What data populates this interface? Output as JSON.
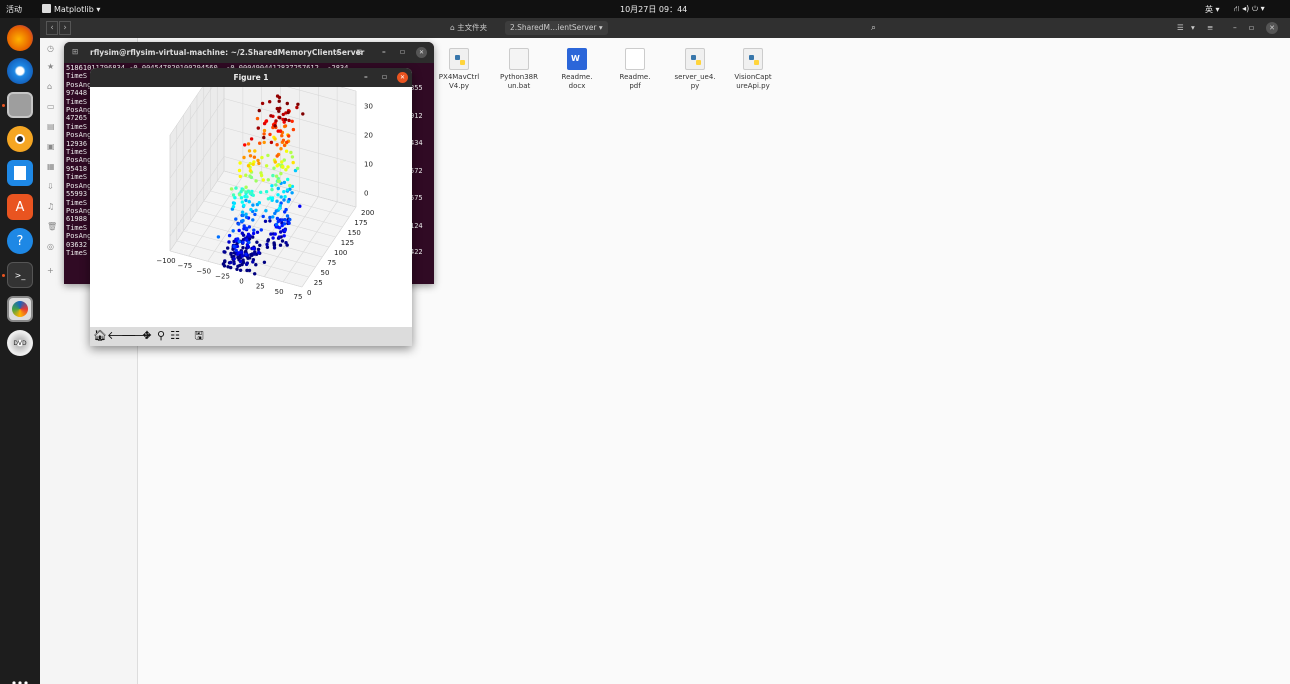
{
  "topbar": {
    "activities": "活动",
    "app_menu": "Matplotlib ▾",
    "clock": "10月27日 09：44",
    "input_method": "英 ▾",
    "status_icons": "⛙ ◂) ⏻ ▾"
  },
  "files": {
    "breadcrumb_home": "主文件夹",
    "breadcrumb_current": "2.SharedM…ientServer",
    "breadcrumb_arrow": "▾",
    "items": [
      {
        "name": "PX4MavCtrl\nV4.py",
        "icon": "python-icon"
      },
      {
        "name": "Python38R\nun.bat",
        "icon": "text-file-icon"
      },
      {
        "name": "Readme.\ndocx",
        "icon": "word-doc-icon"
      },
      {
        "name": "Readme.\npdf",
        "icon": "pdf-icon"
      },
      {
        "name": "server_ue4.\npy",
        "icon": "python-icon"
      },
      {
        "name": "VisionCapt\nureApi.py",
        "icon": "python-icon"
      }
    ]
  },
  "terminal": {
    "title": "rflysim@rflysim-virtual-machine: ~/2.SharedMemoryClientServer",
    "lines": [
      "51861011796834 -0.004547820100294560  -0.0004904412837257612  -2834",
      "TimeS",
      "PosAng",
      "97448",
      "TimeS",
      "PosAng",
      "47265",
      "TimeS",
      "PosAng",
      "12936",
      "TimeS",
      "PosAng",
      "95418",
      "TimeS",
      "PosAng",
      "55993",
      "TimeS",
      "PosAng",
      "61988",
      "TimeS",
      "PosAng",
      "03632",
      "TimeS"
    ],
    "right_values": [
      "855",
      "912",
      "434",
      "572",
      "575",
      "124",
      "422"
    ]
  },
  "figure": {
    "title": "Figure 1",
    "toolbar": [
      "home-icon",
      "back-icon",
      "forward-icon",
      "pan-icon",
      "zoom-icon",
      "configure-icon",
      "save-icon"
    ]
  },
  "chart_data": {
    "type": "scatter",
    "projection": "3d",
    "title": "",
    "xlabel": "",
    "ylabel": "",
    "zlabel": "",
    "x_ticks": [
      "−100",
      "−75",
      "−50",
      "−25",
      "0",
      "25",
      "50",
      "75"
    ],
    "y_ticks": [
      "0",
      "25",
      "50",
      "75",
      "100",
      "125",
      "150",
      "175",
      "200"
    ],
    "z_ticks": [
      "0",
      "10",
      "20",
      "30"
    ],
    "xlim": [
      -100,
      75
    ],
    "ylim": [
      0,
      200
    ],
    "zlim": [
      -5,
      35
    ],
    "colormap": "rainbow (by z)",
    "grid": true,
    "point_clusters": [
      {
        "x": -15,
        "y": 25,
        "z": -5,
        "spread": [
          10,
          20,
          4
        ],
        "n": 120
      },
      {
        "x": -20,
        "y": 60,
        "z": 8,
        "spread": [
          8,
          15,
          10
        ],
        "n": 90
      },
      {
        "x": 10,
        "y": 100,
        "z": 12,
        "spread": [
          8,
          25,
          12
        ],
        "n": 90
      },
      {
        "x": 0,
        "y": 120,
        "z": 28,
        "spread": [
          15,
          20,
          6
        ],
        "n": 60
      },
      {
        "x": 15,
        "y": 80,
        "z": 2,
        "spread": [
          6,
          10,
          6
        ],
        "n": 40
      }
    ]
  }
}
